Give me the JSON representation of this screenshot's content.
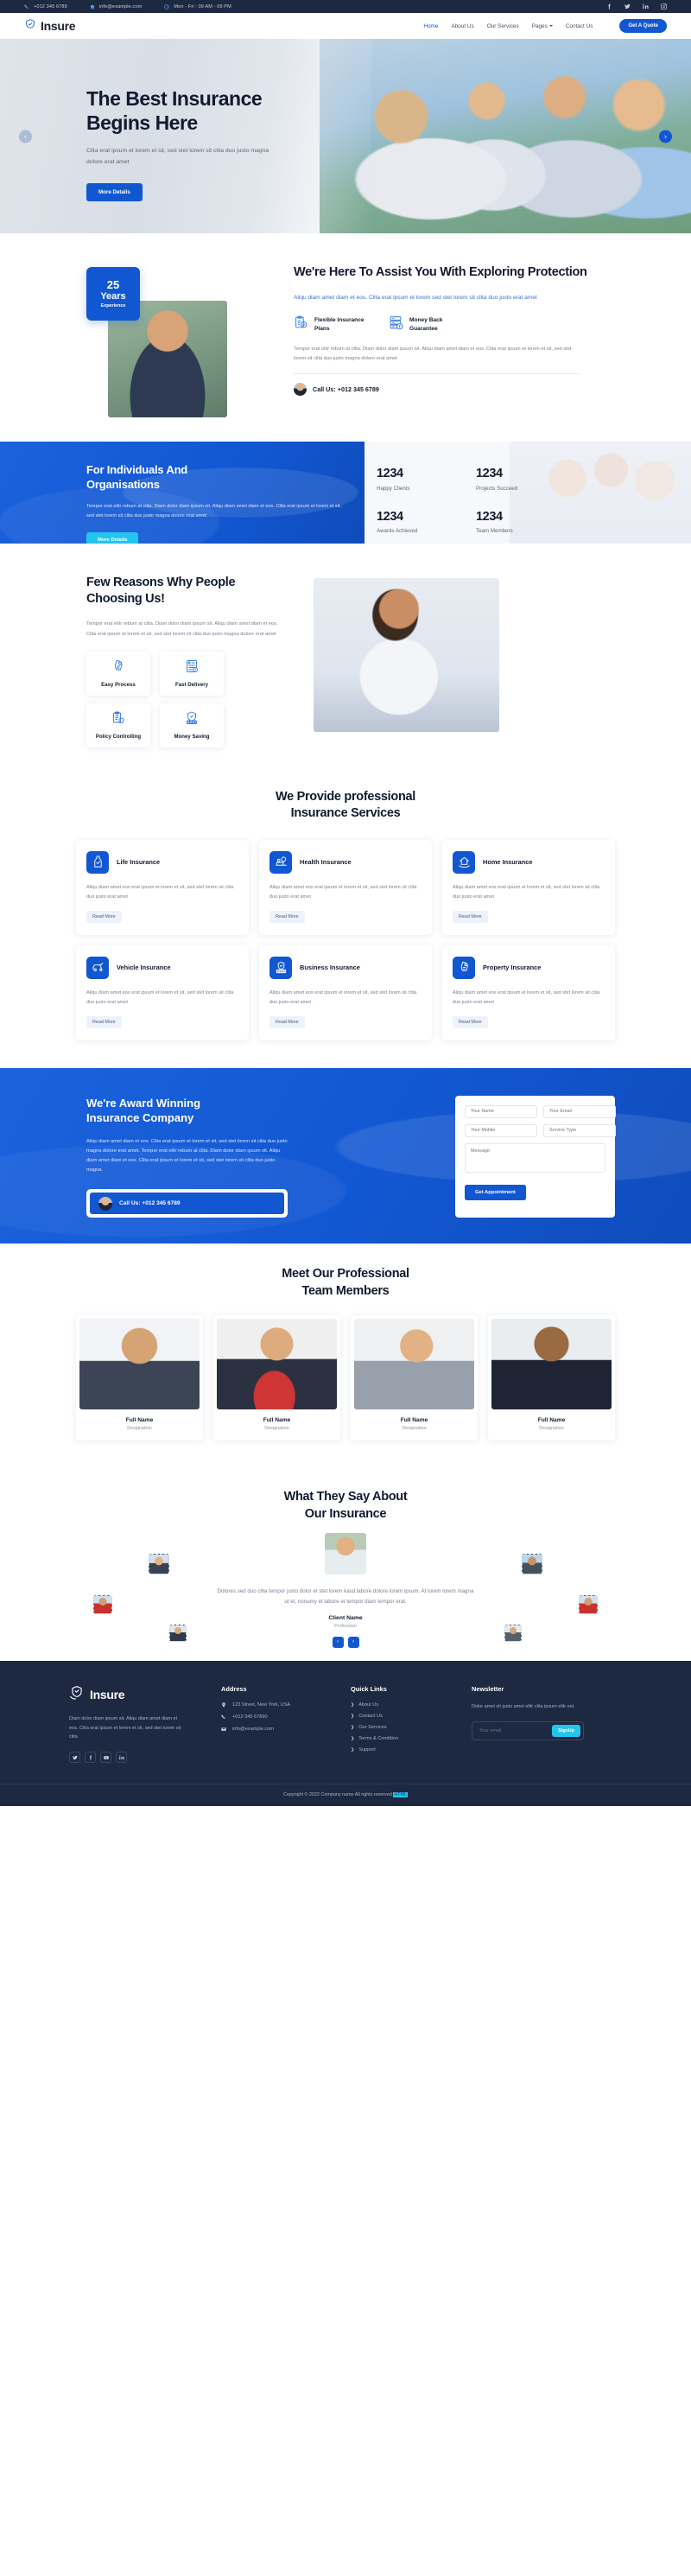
{
  "topbar": {
    "phone": "+012 345 6789",
    "email": "info@example.com",
    "hours": "Mon - Fri : 09 AM - 09 PM",
    "socials": [
      "facebook-icon",
      "twitter-icon",
      "linkedin-icon",
      "instagram-icon"
    ]
  },
  "nav": {
    "brand": "Insure",
    "links": [
      {
        "label": "Home",
        "active": true
      },
      {
        "label": "About Us",
        "active": false
      },
      {
        "label": "Our Services",
        "active": false
      },
      {
        "label": "Pages",
        "active": false,
        "caret": true
      },
      {
        "label": "Contact Us",
        "active": false
      }
    ],
    "cta": "Get A Quote"
  },
  "hero": {
    "title_line1": "The Best Insurance",
    "title_line2": "Begins Here",
    "subtitle": "Clita erat ipsum et lorem et sit, sed stet lorem sit clita duo justo magna dolore erat amet",
    "button": "More Details",
    "prev": "‹",
    "next": "›"
  },
  "assist": {
    "badge_number": "25",
    "badge_years": "Years",
    "badge_experience": "Experience",
    "title": "We're Here To Assist You With Exploring Protection",
    "lead": "Aliqu diam amet diam et eos. Clita erat ipsum et lorem sed stet lorem sit clita duo justo erat amet",
    "features": [
      {
        "label": "Flexible Insurance Plans",
        "icon": "clipboard-check-icon"
      },
      {
        "label": "Money Back Guarantee",
        "icon": "money-list-icon"
      }
    ],
    "body": "Tempor erat elitr rebum at clita. Diam dolor diam ipsum sit. Aliqu diam amet diam et eos. Clita erat ipsum et lorem et sit, sed stet lorem sit clita duo justo magna dolore erat amet",
    "call_label": "Call Us: +012 345 6789"
  },
  "stats": {
    "title_line1": "For Individuals And",
    "title_line2": "Organisations",
    "body": "Tempor erat elitr rebum at clita. Diam dolor diam ipsum sit. Aliqu diam amet diam et eos. Clita erat ipsum et lorem et sit, sed stet lorem sit clita duo justo magna dolore erat amet",
    "button": "More Details",
    "items": [
      {
        "number": "1234",
        "label": "Happy Clients"
      },
      {
        "number": "1234",
        "label": "Projects Succeed"
      },
      {
        "number": "1234",
        "label": "Awards Achieved"
      },
      {
        "number": "1234",
        "label": "Team Members"
      }
    ]
  },
  "reasons": {
    "title_line1": "Few Reasons Why People",
    "title_line2": "Choosing Us!",
    "body": "Tempor erat elitr rebum at clita. Diam dolor diam ipsum sit. Aliqu diam amet diam et eos. Clita erat ipsum et lorem et sit, sed stet lorem sit clita duo justo magna dolore erat amet",
    "cards": [
      {
        "label": "Easy Process",
        "icon": "hand-phone-icon"
      },
      {
        "label": "Fast Delivery",
        "icon": "document-money-icon"
      },
      {
        "label": "Policy Controlling",
        "icon": "clipboard-shield-icon"
      },
      {
        "label": "Money Saving",
        "icon": "shield-coins-icon"
      }
    ]
  },
  "services": {
    "title_line1": "We Provide professional",
    "title_line2": "Insurance Services",
    "read_more": "Read More",
    "description": "Aliqu diam amet eos erat ipsum et lorem et sit, sed stet lorem sit clita duo justo erat amet",
    "cards": [
      {
        "name": "Life Insurance",
        "icon": "life-icon"
      },
      {
        "name": "Health Insurance",
        "icon": "health-bed-icon"
      },
      {
        "name": "Home Insurance",
        "icon": "home-hand-icon"
      },
      {
        "name": "Vehicle Insurance",
        "icon": "car-check-icon"
      },
      {
        "name": "Business Insurance",
        "icon": "building-shield-icon"
      },
      {
        "name": "Property Insurance",
        "icon": "property-icon"
      }
    ]
  },
  "award": {
    "title_line1": "We're Award Winning",
    "title_line2": "Insurance Company",
    "body": "Aliqu diam amet diam et eos. Clita erat ipsum et lorem et sit, sed stet lorem sit clita duo justo magna dolore erat amet. Tempor erat elitr rebum at clita. Diam dolor diam ipsum sit. Aliqu diam amet diam et eos. Clita erat ipsum et lorem et sit, sed stet lorem sit clita duo justo magna.",
    "call_label": "Call Us: +012 345 6789",
    "form": {
      "name_placeholder": "Your Name",
      "email_placeholder": "Your Email",
      "mobile_placeholder": "Your Mobile",
      "service_placeholder": "Service Type",
      "message_placeholder": "Message",
      "submit": "Get Appointment"
    }
  },
  "team": {
    "title_line1": "Meet Our Professional",
    "title_line2": "Team Members",
    "members": [
      {
        "name": "Full Name",
        "designation": "Designation"
      },
      {
        "name": "Full Name",
        "designation": "Designation"
      },
      {
        "name": "Full Name",
        "designation": "Designation"
      },
      {
        "name": "Full Name",
        "designation": "Designation"
      }
    ]
  },
  "testimonials": {
    "title_line1": "What They Say About",
    "title_line2": "Our Insurance",
    "quote": "Dolores sed duo clita tempor justo dolor et stet lorem kasd labore dolore lorem ipsum. At lorem lorem magna ut et, nonumy et labore et tempor diam tempor erat.",
    "client_name": "Client Name",
    "profession": "Profession",
    "prev": "‹",
    "next": "›"
  },
  "footer": {
    "brand": "Insure",
    "about": "Diam dolor diam ipsum sit. Aliqu diam amet diam et eos. Clita erat ipsum et lorem et sit, sed stet lorem sit clita",
    "socials": [
      "twitter-icon",
      "facebook-icon",
      "youtube-icon",
      "linkedin-icon"
    ],
    "address_title": "Address",
    "address_lines": [
      {
        "icon": "map-pin-icon",
        "text": "123 Street, New York, USA"
      },
      {
        "icon": "phone-icon",
        "text": "+012 345 67890"
      },
      {
        "icon": "envelope-icon",
        "text": "info@example.com"
      }
    ],
    "quick_title": "Quick Links",
    "quick_links": [
      "About Us",
      "Contact Us",
      "Our Services",
      "Terms & Condition",
      "Support"
    ],
    "newsletter_title": "Newsletter",
    "newsletter_text": "Dolor amet sit justo amet elitr clita ipsum elitr est.",
    "newsletter_placeholder": "Your email",
    "newsletter_button": "SignUp",
    "copyright_prefix": "Copyright © 2022 Company name All rights reserved",
    "copyright_badge": "HTML"
  },
  "colors": {
    "primary": "#1257d2",
    "dark": "#1d2841",
    "cyan": "#23c5ee",
    "muted": "#7a8294"
  }
}
